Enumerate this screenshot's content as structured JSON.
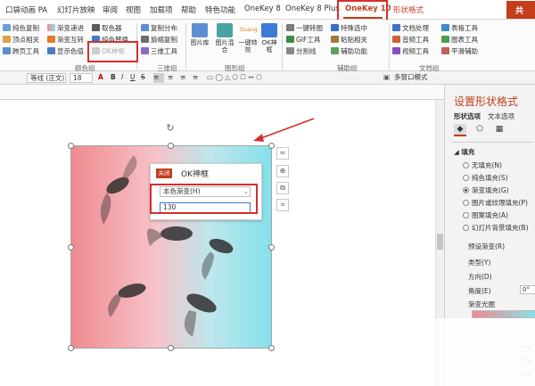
{
  "tabs": [
    "口袋动画 PA",
    "幻灯片放映",
    "审阅",
    "视图",
    "加载项",
    "帮助",
    "特色功能",
    "OneKey 8",
    "OneKey 8 Plus",
    "OneKey 10",
    "形状格式",
    "共"
  ],
  "ribbon": {
    "col1": [
      "纯色复制",
      "顶点相关",
      "跨页工具"
    ],
    "col2": [
      "渐变递进",
      "渐变互转",
      "显示色值"
    ],
    "col3": [
      "取色器",
      "纯色替换",
      "OK神框"
    ],
    "color_group": "颜色组",
    "col4": [
      "复制分布",
      "旋缩复制",
      "三维工具"
    ],
    "col4_group": "三维组",
    "big": [
      "图片库",
      "图片混合",
      "一键特效",
      "OK神框"
    ],
    "big_sub": "Duang",
    "shape_group": "图形组",
    "col5": [
      "一键转图",
      "GIF工具",
      "分割线"
    ],
    "col6": [
      "特殊选中",
      "粘贴相关",
      "辅助功能"
    ],
    "aux_group": "辅助组",
    "col7": [
      "文档处理",
      "音频工具",
      "视频工具"
    ],
    "col8": [
      "表格工具",
      "图表工具",
      "平滑辅助"
    ],
    "doc_group": "文档组"
  },
  "format_bar": {
    "font": "等线 (正文)",
    "size": "18",
    "multi_window": "多窗口模式"
  },
  "dialog": {
    "close_label": "关闭",
    "title": "OK神框",
    "select_value": "本色渐变(H)",
    "input_value": "130"
  },
  "pane": {
    "title": "设置形状格式",
    "tab_shape": "形状选项",
    "tab_text": "文本选项",
    "fill_header": "填充",
    "options": [
      "无填充(N)",
      "纯色填充(S)",
      "渐变填充(G)",
      "图片或纹理填充(P)",
      "图案填充(A)",
      "幻灯片背景填充(B)"
    ],
    "selected_index": 2,
    "preset": "预设渐变(R)",
    "type": "类型(Y)",
    "direction": "方向(D)",
    "angle": "角度(E)",
    "angle_value": "0°",
    "stops": "渐变光圈",
    "pct": [
      "0%",
      "0%",
      "0%"
    ]
  },
  "colors": {
    "accent": "#c43e1c",
    "highlight": "#d32f2f",
    "grad_left": "#f08a8f",
    "grad_right": "#86e1ea"
  }
}
